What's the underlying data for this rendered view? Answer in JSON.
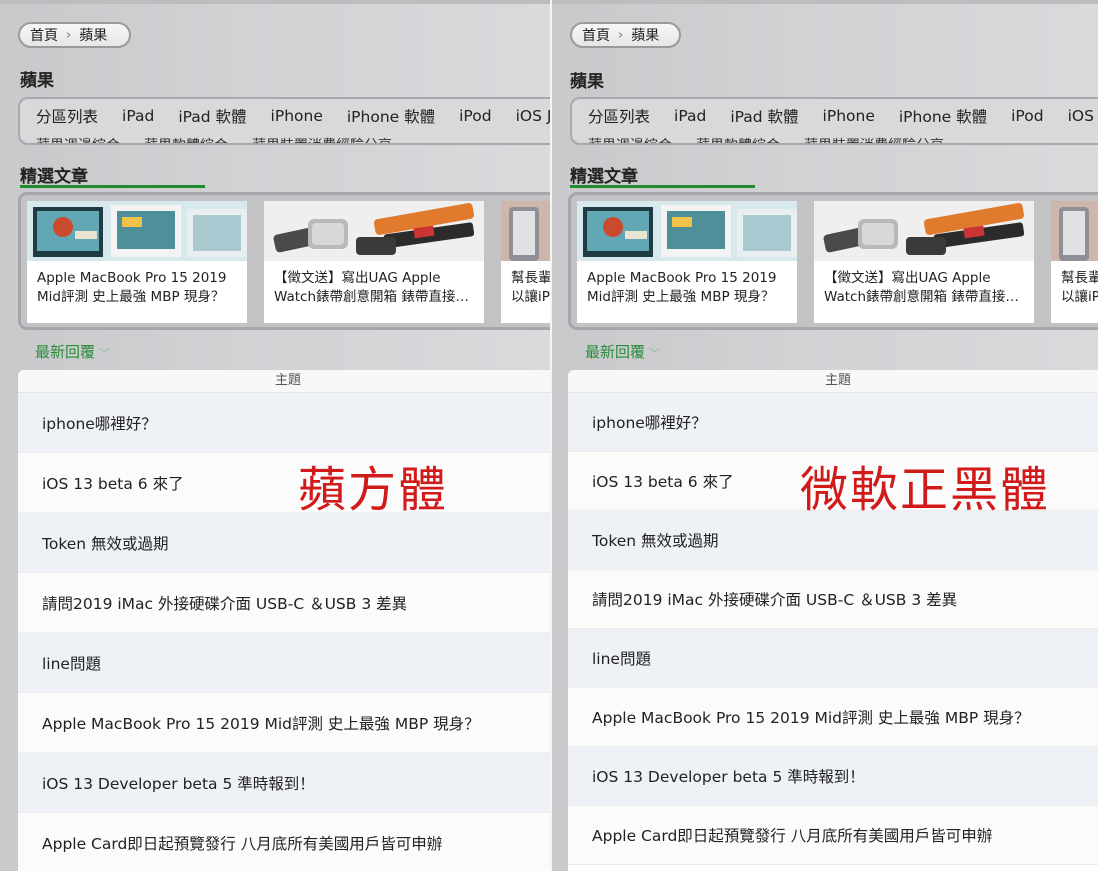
{
  "colors": {
    "accent_green": "#1f8d2c",
    "overlay_red": "#d11a1a"
  },
  "panels": [
    {
      "breadcrumb": {
        "home": "首頁",
        "current": "蘋果"
      },
      "section_title": "蘋果",
      "categories_row1": [
        "分區列表",
        "iPad",
        "iPad 軟體",
        "iPhone",
        "iPhone 軟體",
        "iPod",
        "iOS J"
      ],
      "categories_row2": [
        "蘋果週邊綜合",
        "蘋果軟體綜合",
        "蘋果裝置消費經驗分享"
      ],
      "featured_title": "精選文章",
      "cards": [
        {
          "line1": "Apple MacBook Pro 15 2019",
          "line2": "Mid評測 史上最強 MBP 現身？"
        },
        {
          "line1": "【徵文送】寫出UAG Apple",
          "line2": "Watch錶帶創意開箱 錶帶直接…"
        },
        {
          "line1": "幫長輩",
          "line2": "以讓iP"
        }
      ],
      "latest_label": "最新回覆",
      "table_header": "主題",
      "overlay": "蘋方體",
      "topics": [
        "iphone哪裡好？",
        "iOS 13 beta 6 來了",
        "Token 無效或過期",
        "請問2019 iMac 外接硬碟介面 USB-C ＆USB 3 差異",
        "line問題",
        "Apple MacBook Pro 15 2019 Mid評測 史上最強 MBP 現身？",
        "iOS 13 Developer beta 5 準時報到！",
        "Apple Card即日起預覽發行 八月底所有美國用戶皆可申辦"
      ]
    },
    {
      "breadcrumb": {
        "home": "首頁",
        "current": "蘋果"
      },
      "section_title": "蘋果",
      "categories_row1": [
        "分區列表",
        "iPad",
        "iPad 軟體",
        "iPhone",
        "iPhone 軟體",
        "iPod",
        "iOS J"
      ],
      "categories_row2": [
        "蘋果週邊綜合",
        "蘋果軟體綜合",
        "蘋果裝置消費經驗分享"
      ],
      "featured_title": "精選文章",
      "cards": [
        {
          "line1": "Apple MacBook Pro 15 2019",
          "line2": "Mid評測 史上最強 MBP 現身？"
        },
        {
          "line1": "【徵文送】寫出UAG Apple",
          "line2": "Watch錶帶創意開箱 錶帶直接…"
        },
        {
          "line1": "幫長輩",
          "line2": "以讓iP"
        }
      ],
      "latest_label": "最新回覆",
      "table_header": "主題",
      "overlay": "微軟正黑體",
      "topics": [
        "iphone哪裡好？",
        "iOS 13 beta 6 來了",
        "Token 無效或過期",
        "請問2019 iMac 外接硬碟介面 USB-C ＆USB 3 差異",
        "line問題",
        "Apple MacBook Pro 15 2019 Mid評測 史上最強 MBP 現身？",
        "iOS 13 Developer beta 5 準時報到！",
        "Apple Card即日起預覽發行 八月底所有美國用戶皆可申辦"
      ]
    }
  ]
}
